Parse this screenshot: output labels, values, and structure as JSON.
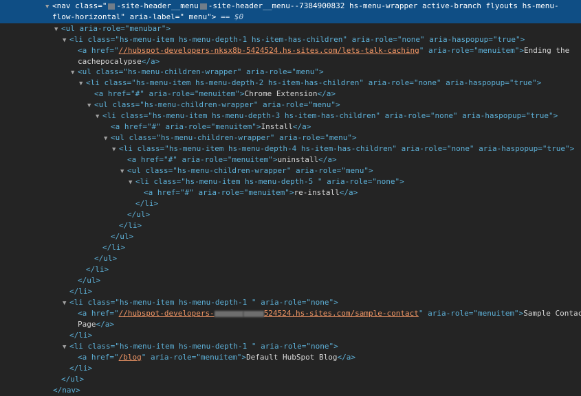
{
  "selected": {
    "line1_tag": "<nav class=\"",
    "line1_cls1": "-site-header__menu",
    "line1_cls2": "-site-header__menu--7384900832 hs-menu-wrapper active-branch flyouts hs-menu-",
    "line2": "flow-horizontal\" aria-label=\" menu\">",
    "eq": "== $0"
  },
  "lines": {
    "l1": "<ul aria-role=\"menubar\">",
    "l2": "<li class=\"hs-menu-item hs-menu-depth-1 hs-item-has-children\" aria-role=\"none\" aria-haspopup=\"true\">",
    "l3a_tag": "<a href=\"",
    "l3a_href": "//hubspot-developers-nksx8b-5424524.hs-sites.com/lets-talk-caching",
    "l3a_rest": "\" aria-role=\"menuitem\">",
    "l3a_text": "Ending the",
    "l3b_text": "cachepocalypse",
    "l3b_close": "</a>",
    "l4": "<ul class=\"hs-menu-children-wrapper\" aria-role=\"menu\">",
    "l5": "<li class=\"hs-menu-item hs-menu-depth-2 hs-item-has-children\" aria-role=\"none\" aria-haspopup=\"true\">",
    "l6_tag": "<a href=\"#\" aria-role=\"menuitem\">",
    "l6_text": "Chrome Extension",
    "l6_close": "</a>",
    "l7": "<ul class=\"hs-menu-children-wrapper\" aria-role=\"menu\">",
    "l8": "<li class=\"hs-menu-item hs-menu-depth-3 hs-item-has-children\" aria-role=\"none\" aria-haspopup=\"true\">",
    "l9_tag": "<a href=\"#\" aria-role=\"menuitem\">",
    "l9_text": "Install",
    "l9_close": "</a>",
    "l10": "<ul class=\"hs-menu-children-wrapper\" aria-role=\"menu\">",
    "l11": "<li class=\"hs-menu-item hs-menu-depth-4 hs-item-has-children\" aria-role=\"none\" aria-haspopup=\"true\">",
    "l12_tag": "<a href=\"#\" aria-role=\"menuitem\">",
    "l12_text": "uninstall",
    "l12_close": "</a>",
    "l13": "<ul class=\"hs-menu-children-wrapper\" aria-role=\"menu\">",
    "l14": "<li class=\"hs-menu-item hs-menu-depth-5 \" aria-role=\"none\">",
    "l15_tag": "<a href=\"#\" aria-role=\"menuitem\">",
    "l15_text": "re-install",
    "l15_close": "</a>",
    "close_li": "</li>",
    "close_ul": "</ul>",
    "l26": "<li class=\"hs-menu-item hs-menu-depth-1 \" aria-role=\"none\">",
    "l27_tag": "<a href=\"",
    "l27_href_a": "//hubspot-developers-",
    "l27_href_b": "524524.hs-sites.com/sample-contact",
    "l27_rest": "\" aria-role=\"menuitem\">",
    "l27_text": "Sample Contact",
    "l28_text": "Page",
    "l28_close": "</a>",
    "l30": "<li class=\"hs-menu-item hs-menu-depth-1 \" aria-role=\"none\">",
    "l31_tag": "<a href=\"",
    "l31_href": "/blog",
    "l31_rest": "\" aria-role=\"menuitem\">",
    "l31_text": "Default HubSpot Blog",
    "l31_close": "</a>",
    "close_nav": "</nav>"
  },
  "colors": {
    "background": "#242424",
    "selection": "#0f4e85",
    "tag": "#5db0d7",
    "attr_value": "#f29766"
  }
}
